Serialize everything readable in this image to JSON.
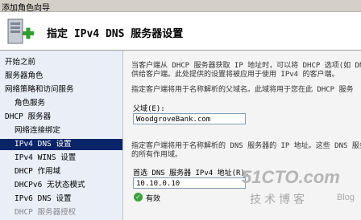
{
  "window": {
    "title": "添加角色向导"
  },
  "banner": {
    "title": "指定 IPv4 DNS 服务器设置"
  },
  "sidebar": {
    "items": [
      {
        "label": "开始之前",
        "state": "normal"
      },
      {
        "label": "服务器角色",
        "state": "normal"
      },
      {
        "label": "网络策略和访问服务",
        "state": "normal"
      },
      {
        "label": "角色服务",
        "state": "normal"
      },
      {
        "label": "DHCP 服务器",
        "state": "normal"
      },
      {
        "label": "网络连接绑定",
        "state": "normal"
      },
      {
        "label": "IPv4 DNS 设置",
        "state": "selected"
      },
      {
        "label": "IPv4 WINS 设置",
        "state": "normal"
      },
      {
        "label": "DHCP 作用域",
        "state": "normal"
      },
      {
        "label": "DHCPv6 无状态模式",
        "state": "normal"
      },
      {
        "label": "IPv6 DNS 设置",
        "state": "normal"
      },
      {
        "label": "DHCP 服务器授权",
        "state": "disabled"
      }
    ]
  },
  "main": {
    "intro_line1": "当客户端从 DHCP 服务器获取 IP 地址时，可以将 DHCP 选项(如 DNS",
    "intro_line2": "供给客户端。此处提供的设置将被应用于使用 IPv4 的客户端。",
    "parent_domain_hint": "指定客户端将用于名称解析的父域名。此域将用于您在此 DHCP 服务",
    "parent_domain_label": "父域(E):",
    "parent_domain_value": "WoodgroveBank.com",
    "dns_hint_line1": "指定客户端将用于名称解析的 DNS 服务器的 IP 地址。这些 DNS 服务",
    "dns_hint_line2": "的所有作用域。",
    "preferred_dns_label": "首选 DNS 服务器 IPv4 地址(R):",
    "preferred_dns_value": "10.10.0.10",
    "valid_text": "有效",
    "valid_color": "#3aa23a"
  },
  "watermark": {
    "main": "51CTO.com",
    "sub": "技术博客",
    "blog": "Blog"
  }
}
